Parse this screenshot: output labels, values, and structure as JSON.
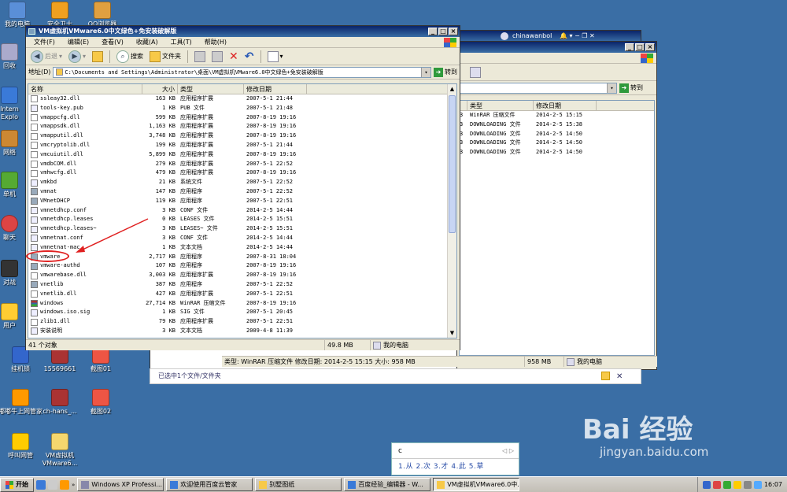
{
  "desktop_icons": [
    {
      "label": "我的电脑",
      "color": "#5a8fd8"
    },
    {
      "label": "安全卫士",
      "color": "#f0a020"
    },
    {
      "label": "QQ浏览器",
      "color": "#e0a040"
    },
    {
      "label": "回收",
      "color": "#aac"
    },
    {
      "label": "Intern Explo",
      "color": "#3a7ad8"
    },
    {
      "label": "网络",
      "color": "#c83"
    },
    {
      "label": "单机",
      "color": "#5a3"
    },
    {
      "label": "聊天",
      "color": "#d44"
    },
    {
      "label": "对战",
      "color": "#333"
    },
    {
      "label": "用户",
      "color": "#fc3"
    },
    {
      "label": "挂机锁",
      "color": "#36c"
    },
    {
      "label": "15569661",
      "color": "#a33"
    },
    {
      "label": "截图01",
      "color": "#e54"
    },
    {
      "label": "嘟嘟牛上网管家",
      "color": "#f90"
    },
    {
      "label": "ch-hans_...",
      "color": "#a33"
    },
    {
      "label": "截图02",
      "color": "#e54"
    },
    {
      "label": "呼叫网管",
      "color": "#fc0"
    },
    {
      "label": "VM虚拟机 VMware6...",
      "color": "#f5d76e"
    }
  ],
  "bg_window": {
    "user": "chinawanbol",
    "columns": {
      "type": "类型",
      "date": "修改日期"
    },
    "rows": [
      {
        "type": "WinRAR 压缩文件",
        "date": "2014-2-5 15:15"
      },
      {
        "type": "DOWNLOADING 文件",
        "date": "2014-2-5 15:38"
      },
      {
        "type": "DOWNLOADING 文件",
        "date": "2014-2-5 14:50"
      },
      {
        "type": "DOWNLOADING 文件",
        "date": "2014-2-5 14:50"
      },
      {
        "type": "DOWNLOADING 文件",
        "date": "2014-2-5 14:50"
      }
    ],
    "go_label": "转到",
    "status_info": "类型: WinRAR 压缩文件 修改日期: 2014-2-5 15:15 大小: 958 MB",
    "status_size": "958 MB",
    "status_location": "我的电脑",
    "bottom_text": "已选中1个文件/文件夹"
  },
  "main_window": {
    "title": "VM虚拟机VMware6.0中文绿色+免安装破解版",
    "menu": [
      "文件(F)",
      "编辑(E)",
      "查看(V)",
      "收藏(A)",
      "工具(T)",
      "帮助(H)"
    ],
    "toolbar": {
      "back": "后退",
      "search": "搜索",
      "folders": "文件夹"
    },
    "address_label": "地址(D)",
    "address_value": "C:\\Documents and Settings\\Administrator\\桌面\\VM虚拟机VMware6.0中文绿色+免安装破解版",
    "go_label": "转到",
    "columns": {
      "name": "名称",
      "size": "大小",
      "type": "类型",
      "date": "修改日期"
    },
    "files": [
      {
        "name": "ssleay32.dll",
        "size": "163 KB",
        "type": "应用程序扩展",
        "date": "2007-5-1 21:44",
        "icon": "dll"
      },
      {
        "name": "tools-key.pub",
        "size": "1 KB",
        "type": "PUB 文件",
        "date": "2007-5-1 21:48",
        "icon": "file"
      },
      {
        "name": "vmappcfg.dll",
        "size": "599 KB",
        "type": "应用程序扩展",
        "date": "2007-8-19 19:16",
        "icon": "dll"
      },
      {
        "name": "vmappsdk.dll",
        "size": "1,163 KB",
        "type": "应用程序扩展",
        "date": "2007-8-19 19:16",
        "icon": "dll"
      },
      {
        "name": "vmapputil.dll",
        "size": "3,748 KB",
        "type": "应用程序扩展",
        "date": "2007-8-19 19:16",
        "icon": "dll"
      },
      {
        "name": "vmcryptolib.dll",
        "size": "199 KB",
        "type": "应用程序扩展",
        "date": "2007-5-1 21:44",
        "icon": "dll"
      },
      {
        "name": "vmcuiutil.dll",
        "size": "5,899 KB",
        "type": "应用程序扩展",
        "date": "2007-8-19 19:16",
        "icon": "dll"
      },
      {
        "name": "vmdbCOM.dll",
        "size": "279 KB",
        "type": "应用程序扩展",
        "date": "2007-5-1 22:52",
        "icon": "dll"
      },
      {
        "name": "vmhwcfg.dll",
        "size": "479 KB",
        "type": "应用程序扩展",
        "date": "2007-8-19 19:16",
        "icon": "dll"
      },
      {
        "name": "vmkbd",
        "size": "21 KB",
        "type": "系统文件",
        "date": "2007-5-1 22:52",
        "icon": "file"
      },
      {
        "name": "vmnat",
        "size": "147 KB",
        "type": "应用程序",
        "date": "2007-5-1 22:52",
        "icon": "app"
      },
      {
        "name": "VMnetDHCP",
        "size": "119 KB",
        "type": "应用程序",
        "date": "2007-5-1 22:51",
        "icon": "app"
      },
      {
        "name": "vmnetdhcp.conf",
        "size": "3 KB",
        "type": "CONF 文件",
        "date": "2014-2-5 14:44",
        "icon": "file"
      },
      {
        "name": "vmnetdhcp.leases",
        "size": "0 KB",
        "type": "LEASES 文件",
        "date": "2014-2-5 15:51",
        "icon": "file"
      },
      {
        "name": "vmnetdhcp.leases~",
        "size": "3 KB",
        "type": "LEASES~ 文件",
        "date": "2014-2-5 15:51",
        "icon": "file"
      },
      {
        "name": "vmnetnat.conf",
        "size": "3 KB",
        "type": "CONF 文件",
        "date": "2014-2-5 14:44",
        "icon": "file"
      },
      {
        "name": "vmnetnat-mac",
        "size": "1 KB",
        "type": "文本文档",
        "date": "2014-2-5 14:44",
        "icon": "file"
      },
      {
        "name": "vmware",
        "size": "2,717 KB",
        "type": "应用程序",
        "date": "2007-8-31 18:04",
        "icon": "app"
      },
      {
        "name": "vmware-authd",
        "size": "107 KB",
        "type": "应用程序",
        "date": "2007-8-19 19:16",
        "icon": "app"
      },
      {
        "name": "vmwarebase.dll",
        "size": "3,003 KB",
        "type": "应用程序扩展",
        "date": "2007-8-19 19:16",
        "icon": "dll"
      },
      {
        "name": "vnetlib",
        "size": "387 KB",
        "type": "应用程序",
        "date": "2007-5-1 22:52",
        "icon": "app"
      },
      {
        "name": "vnetlib.dll",
        "size": "427 KB",
        "type": "应用程序扩展",
        "date": "2007-5-1 22:51",
        "icon": "dll"
      },
      {
        "name": "windows",
        "size": "27,714 KB",
        "type": "WinRAR 压缩文件",
        "date": "2007-8-19 19:16",
        "icon": "rar"
      },
      {
        "name": "windows.iso.sig",
        "size": "1 KB",
        "type": "SIG 文件",
        "date": "2007-5-1 20:45",
        "icon": "file"
      },
      {
        "name": "zlib1.dll",
        "size": "79 KB",
        "type": "应用程序扩展",
        "date": "2007-5-1 22:51",
        "icon": "dll"
      },
      {
        "name": "安装说明",
        "size": "3 KB",
        "type": "文本文档",
        "date": "2009-4-8 11:39",
        "icon": "file"
      }
    ],
    "status_count": "41 个对象",
    "status_size": "49.8 MB",
    "status_location": "我的电脑"
  },
  "ime": {
    "input": "c",
    "candidates": "1.从 2.次 3.才 4.此 5.草",
    "nav": "◁ ▷"
  },
  "watermark": {
    "big": "Bai 经验",
    "small": "jingyan.baidu.com"
  },
  "taskbar": {
    "start": "开始",
    "tasks": [
      "Windows XP Professi...",
      "欢迎使用百度云管家",
      "别墅图纸",
      "百度经验_编辑器 - W...",
      "VM虚拟机VMware6.0中..."
    ],
    "clock": "16:07"
  },
  "colors": {
    "desktop": "#3a6ea5",
    "titlebar": "#0a246a",
    "annotation": "#e02020"
  }
}
